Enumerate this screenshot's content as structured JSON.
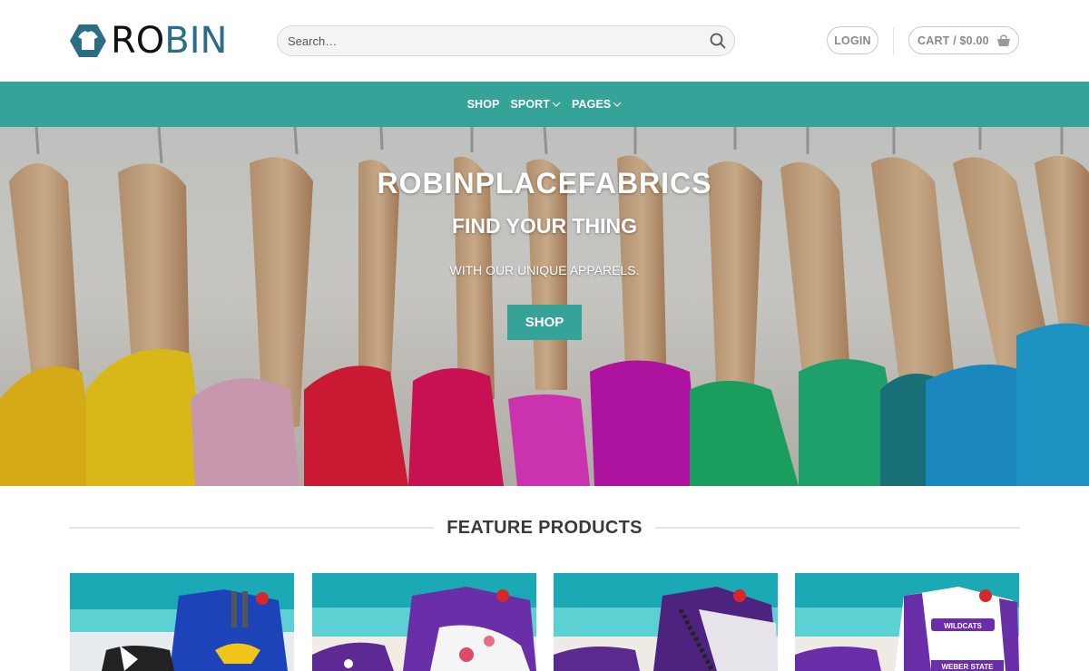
{
  "header": {
    "logo": {
      "text_dark": "RO",
      "text_accent": "BIN",
      "icon": "shirt-hexagon-icon",
      "colors": {
        "dark": "#111111",
        "accent": "#2b6d86"
      }
    },
    "search": {
      "placeholder": "Search…",
      "icon": "search-icon"
    },
    "login_label": "LOGIN",
    "cart_label": "CART / $0.00",
    "cart_icon": "shopping-bag-icon"
  },
  "nav": {
    "color": "#35a397",
    "items": [
      {
        "label": "SHOP",
        "has_dropdown": false
      },
      {
        "label": "SPORT",
        "has_dropdown": true
      },
      {
        "label": "PAGES",
        "has_dropdown": true
      }
    ]
  },
  "hero": {
    "title": "ROBINPLACEFABRICS",
    "subtitle": "FIND YOUR THING",
    "tagline": "WITH OUR UNIQUE APPARELS.",
    "button_label": "SHOP"
  },
  "feature": {
    "heading": "FEATURE PRODUCTS",
    "products": [
      {
        "name": "blue-eagle-hawaiian-shirt",
        "main_color": "#1c43b8"
      },
      {
        "name": "purple-floral-hawaiian-shirt",
        "main_color": "#6a2ea8"
      },
      {
        "name": "purple-tribal-hawaiian-shirt",
        "main_color": "#5a2a8e"
      },
      {
        "name": "wildcats-weber-state-hawaiian-shirt",
        "main_color": "#ffffff",
        "print_text_1": "WILDCATS",
        "print_text_2": "WEBER STATE"
      }
    ]
  }
}
